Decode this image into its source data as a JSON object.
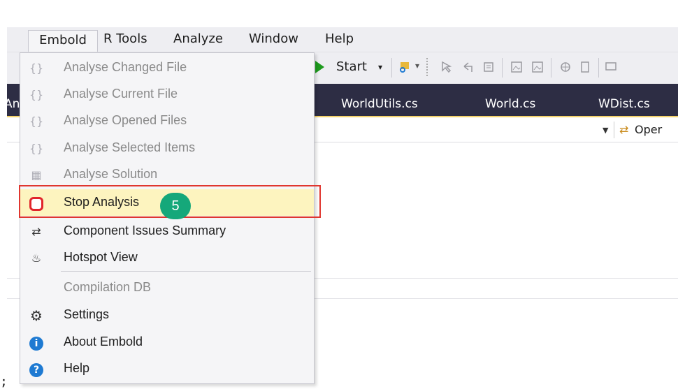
{
  "menubar": {
    "items": [
      "Embold",
      "R Tools",
      "Analyze",
      "Window",
      "Help"
    ]
  },
  "toolbar": {
    "start_label": "Start"
  },
  "tabs": {
    "partial": "An",
    "items": [
      "WorldUtils.cs",
      "World.cs",
      "WDist.cs"
    ]
  },
  "navbar": {
    "label": "Oper"
  },
  "editor": {
    "text": ";"
  },
  "menu": {
    "items": [
      {
        "label": "Analyse Changed File",
        "icon": "braces-icon",
        "enabled": false
      },
      {
        "label": "Analyse Current File",
        "icon": "braces-icon",
        "enabled": false
      },
      {
        "label": "Analyse Opened Files",
        "icon": "braces-icon",
        "enabled": false
      },
      {
        "label": "Analyse Selected Items",
        "icon": "braces-icon",
        "enabled": false
      },
      {
        "label": "Analyse Solution",
        "icon": "solution-icon",
        "enabled": false
      },
      {
        "label": "Stop Analysis",
        "icon": "stop-icon",
        "enabled": true,
        "highlighted": true
      },
      {
        "label": "Component Issues Summary",
        "icon": "component-icon",
        "enabled": true
      },
      {
        "label": "Hotspot View",
        "icon": "flame-icon",
        "enabled": true
      },
      {
        "label": "Compilation DB",
        "icon": "",
        "enabled": false
      },
      {
        "label": "Settings",
        "icon": "gear-icon",
        "enabled": true
      },
      {
        "label": "About Embold",
        "icon": "info-icon",
        "enabled": true
      },
      {
        "label": "Help",
        "icon": "help-icon",
        "enabled": true
      }
    ]
  },
  "callout": {
    "step": "5"
  },
  "colors": {
    "highlight_border": "#e0362f",
    "badge": "#15a87a",
    "tabstrip": "#2d2d44",
    "stop_icon": "#e1262c"
  }
}
